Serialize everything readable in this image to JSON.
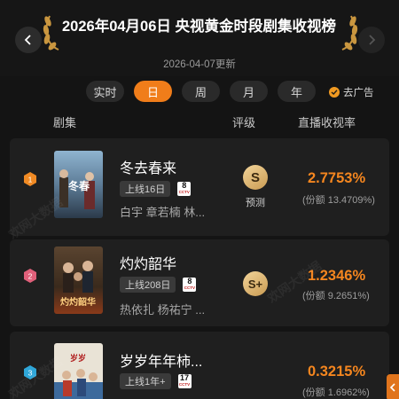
{
  "header": {
    "title": "2026年04月06日 央视黄金时段剧集收视榜",
    "updated": "2026-04-07更新"
  },
  "tabs": [
    {
      "label": "实时",
      "active": false
    },
    {
      "label": "日",
      "active": true
    },
    {
      "label": "周",
      "active": false
    },
    {
      "label": "月",
      "active": false
    },
    {
      "label": "年",
      "active": false
    }
  ],
  "ad_toggle": {
    "label": "去广告",
    "checked": true
  },
  "columns": {
    "series": "剧集",
    "rating": "评级",
    "live": "直播收视率"
  },
  "rows": [
    {
      "rank": "1",
      "name": "冬去春来",
      "online": "上线16日",
      "channel_num": "8",
      "channel_brand": "CCTV",
      "cast": "白宇 章若楠 林...",
      "grade": "S",
      "grade_note": "预测",
      "rate": "2.7753%",
      "share": "(份额 13.4709%)"
    },
    {
      "rank": "2",
      "name": "灼灼韶华",
      "online": "上线208日",
      "channel_num": "8",
      "channel_brand": "CCTV",
      "cast": "热依扎 杨祐宁 ...",
      "grade": "S+",
      "grade_note": "",
      "rate": "1.2346%",
      "share": "(份额 9.2651%)"
    },
    {
      "rank": "3",
      "name": "岁岁年年柿...",
      "online": "上线1年+",
      "channel_num": "17",
      "channel_brand": "CCTV",
      "cast": "",
      "grade": "",
      "grade_note": "",
      "rate": "0.3215%",
      "share": "(份额 1.6962%)"
    }
  ],
  "watermark": "欢网大数据",
  "colors": {
    "accent": "#f07d1a",
    "rate": "#f5861f",
    "rank1": "#f08a24",
    "rank2": "#e0607a",
    "rank3": "#2fa6d8"
  }
}
